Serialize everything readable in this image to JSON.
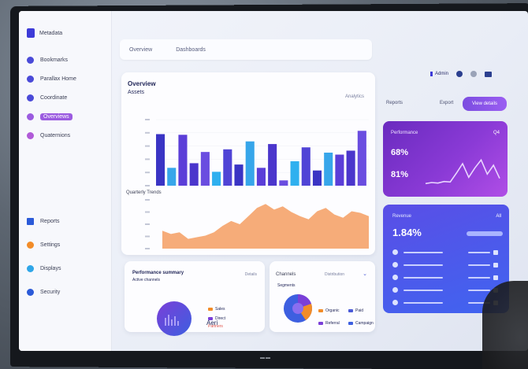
{
  "sidebar": {
    "logo_label": "Metadata",
    "items": [
      {
        "label": "Bookmarks",
        "icon": "home-icon"
      },
      {
        "label": "Parallax Home",
        "icon": "layers-icon"
      },
      {
        "label": "Coordinate",
        "icon": "circle-icon"
      },
      {
        "label": "Overviews",
        "icon": "chart-icon",
        "active": true
      },
      {
        "label": "Quaternions",
        "icon": "globe-icon"
      }
    ],
    "bottom_items": [
      {
        "label": "Reports",
        "icon": "document-icon"
      },
      {
        "label": "Settings",
        "icon": "gear-icon"
      },
      {
        "label": "Displays",
        "icon": "monitor-icon"
      },
      {
        "label": "Security",
        "icon": "shield-icon"
      }
    ]
  },
  "topbar": {
    "tab1": "Overview",
    "tab2": "Dashboards"
  },
  "top_right": {
    "user": "Admin"
  },
  "main_card": {
    "title": "Overview",
    "subtitle": "Assets",
    "link": "Analytics",
    "section2": "Quarterly Trends"
  },
  "right_header": {
    "label_a": "Reports",
    "label_b": "Export",
    "button": "View details"
  },
  "purple_card": {
    "title": "Performance",
    "corner": "Q4",
    "value1": "68%",
    "value2": "81%"
  },
  "blue_card": {
    "title": "Revenue",
    "corner": "All",
    "value": "1.84%"
  },
  "bottom_left": {
    "title": "Performance summary",
    "subtitle": "Active channels",
    "right": "Details",
    "legend": [
      {
        "label": "Sales",
        "color": "#f28c28"
      },
      {
        "label": "Direct",
        "color": "#7a3fd8"
      },
      {
        "label": "Partners",
        "color": "#e0524a"
      }
    ],
    "center_text": "Aeri"
  },
  "bottom_mid": {
    "title": "Channels",
    "right": "Distribution",
    "sub": "Segments",
    "legend": [
      {
        "label": "Organic",
        "color": "#f28c28"
      },
      {
        "label": "Paid",
        "color": "#4a5ad8"
      },
      {
        "label": "Referral",
        "color": "#7a3fd8"
      },
      {
        "label": "Campaign",
        "color": "#3d5fe0"
      }
    ]
  },
  "chart_data": [
    {
      "type": "bar",
      "categories": [
        "",
        "",
        "",
        "",
        "",
        "",
        "",
        "",
        "",
        "",
        "",
        "",
        "",
        "",
        "",
        "",
        "",
        "",
        "",
        "",
        "",
        "",
        ""
      ],
      "series": [
        {
          "values": [
            78,
            27,
            77,
            34,
            51,
            21,
            55,
            32,
            67,
            27,
            63,
            8,
            37,
            58,
            23,
            50,
            47,
            53,
            83,
            0,
            0,
            0,
            0
          ]
        }
      ],
      "ylim": [
        0,
        100
      ],
      "colors": [
        "#3a34c4",
        "#37a6ea",
        "#5b3ed8",
        "#4b36cc",
        "#6a4de0",
        "#2fb0ef",
        "#5044d6"
      ]
    },
    {
      "type": "area",
      "x": [
        0,
        1,
        2,
        3,
        4,
        5,
        6,
        7,
        8,
        9,
        10,
        11,
        12,
        13,
        14,
        15,
        16,
        17,
        18,
        19,
        20,
        21,
        22,
        23,
        24
      ],
      "values": [
        22,
        18,
        20,
        12,
        14,
        16,
        20,
        28,
        34,
        30,
        40,
        50,
        55,
        48,
        52,
        45,
        40,
        36,
        46,
        50,
        42,
        38,
        46,
        44,
        40
      ],
      "ylim": [
        0,
        60
      ]
    },
    {
      "type": "line",
      "x": [
        0,
        1,
        2,
        3,
        4,
        5,
        6,
        7,
        8,
        9,
        10,
        11,
        12
      ],
      "values": [
        10,
        12,
        11,
        14,
        13,
        30,
        48,
        22,
        40,
        55,
        28,
        45,
        20
      ],
      "ylim": [
        0,
        60
      ]
    }
  ]
}
